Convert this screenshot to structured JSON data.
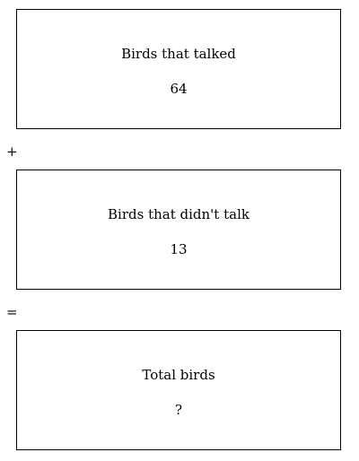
{
  "boxes": [
    {
      "label": "Birds that talked",
      "value": "64"
    },
    {
      "label": "Birds that didn't talk",
      "value": "13"
    },
    {
      "label": "Total birds",
      "value": "?"
    }
  ],
  "operators": {
    "plus": "+",
    "equals": "="
  }
}
